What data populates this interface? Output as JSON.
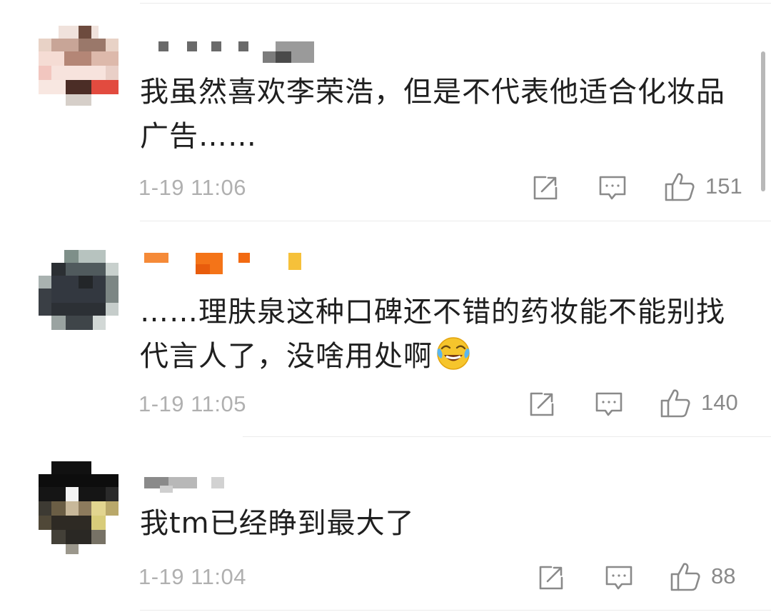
{
  "comments": [
    {
      "text": "我虽然喜欢李荣浩，但是不代表他适合化妆品广告……",
      "time": "1-19 11:06",
      "likes": "151",
      "share_icon": "share-icon",
      "reply_icon": "comment-icon",
      "like_icon": "thumb-up-icon"
    },
    {
      "text": "……理肤泉这种口碑还不错的药妆能不能别找代言人了，没啥用处啊",
      "emoji": "laugh-cry-emoji",
      "time": "1-19 11:05",
      "likes": "140",
      "share_icon": "share-icon",
      "reply_icon": "comment-icon",
      "like_icon": "thumb-up-icon"
    },
    {
      "text": "我tm已经睁到最大了",
      "time": "1-19 11:04",
      "likes": "88",
      "share_icon": "share-icon",
      "reply_icon": "comment-icon",
      "like_icon": "thumb-up-icon"
    }
  ],
  "colors": {
    "text": "#1f1f1f",
    "meta": "#b0b0b0",
    "icon": "#8a8a8a",
    "divider": "#ebebeb"
  }
}
